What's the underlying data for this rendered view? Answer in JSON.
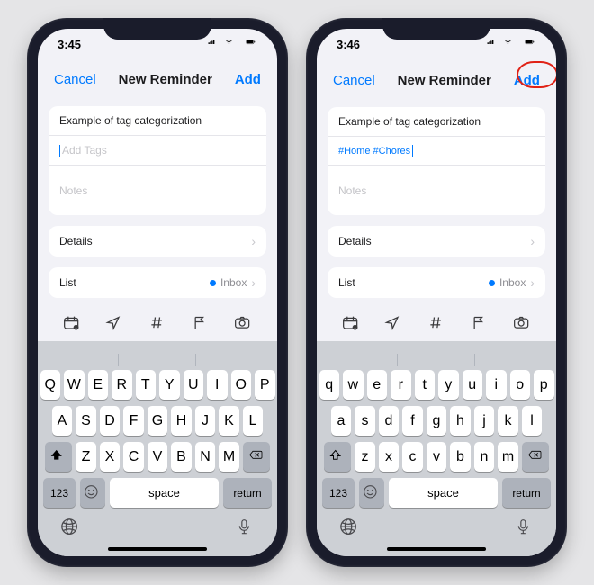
{
  "phones": [
    {
      "time": "3:45",
      "nav": {
        "cancel": "Cancel",
        "title": "New Reminder",
        "add": "Add",
        "highlight_add": false
      },
      "reminder": {
        "title": "Example of tag categorization",
        "tags_display": "",
        "tags_placeholder": "Add Tags",
        "notes_placeholder": "Notes",
        "details_label": "Details",
        "list_label": "List",
        "list_value": "Inbox"
      },
      "keyboard": {
        "uppercase": true,
        "row1": [
          "Q",
          "W",
          "E",
          "R",
          "T",
          "Y",
          "U",
          "I",
          "O",
          "P"
        ],
        "row2": [
          "A",
          "S",
          "D",
          "F",
          "G",
          "H",
          "J",
          "K",
          "L"
        ],
        "row3": [
          "Z",
          "X",
          "C",
          "V",
          "B",
          "N",
          "M"
        ],
        "numkey": "123",
        "space": "space",
        "return": "return"
      }
    },
    {
      "time": "3:46",
      "nav": {
        "cancel": "Cancel",
        "title": "New Reminder",
        "add": "Add",
        "highlight_add": true
      },
      "reminder": {
        "title": "Example of tag categorization",
        "tags_display": "#Home #Chores",
        "tags_placeholder": "Add Tags",
        "notes_placeholder": "Notes",
        "details_label": "Details",
        "list_label": "List",
        "list_value": "Inbox"
      },
      "keyboard": {
        "uppercase": false,
        "row1": [
          "q",
          "w",
          "e",
          "r",
          "t",
          "y",
          "u",
          "i",
          "o",
          "p"
        ],
        "row2": [
          "a",
          "s",
          "d",
          "f",
          "g",
          "h",
          "j",
          "k",
          "l"
        ],
        "row3": [
          "z",
          "x",
          "c",
          "v",
          "b",
          "n",
          "m"
        ],
        "numkey": "123",
        "space": "space",
        "return": "return"
      }
    }
  ],
  "icons": {
    "calendar": "calendar-icon",
    "location": "location-icon",
    "tag": "hashtag-icon",
    "flag": "flag-icon",
    "camera": "camera-icon",
    "globe": "globe-icon",
    "mic": "mic-icon",
    "emoji": "emoji-icon",
    "shift": "shift-icon",
    "delete": "delete-icon"
  },
  "colors": {
    "accent": "#007aff",
    "highlight": "#e02216"
  }
}
